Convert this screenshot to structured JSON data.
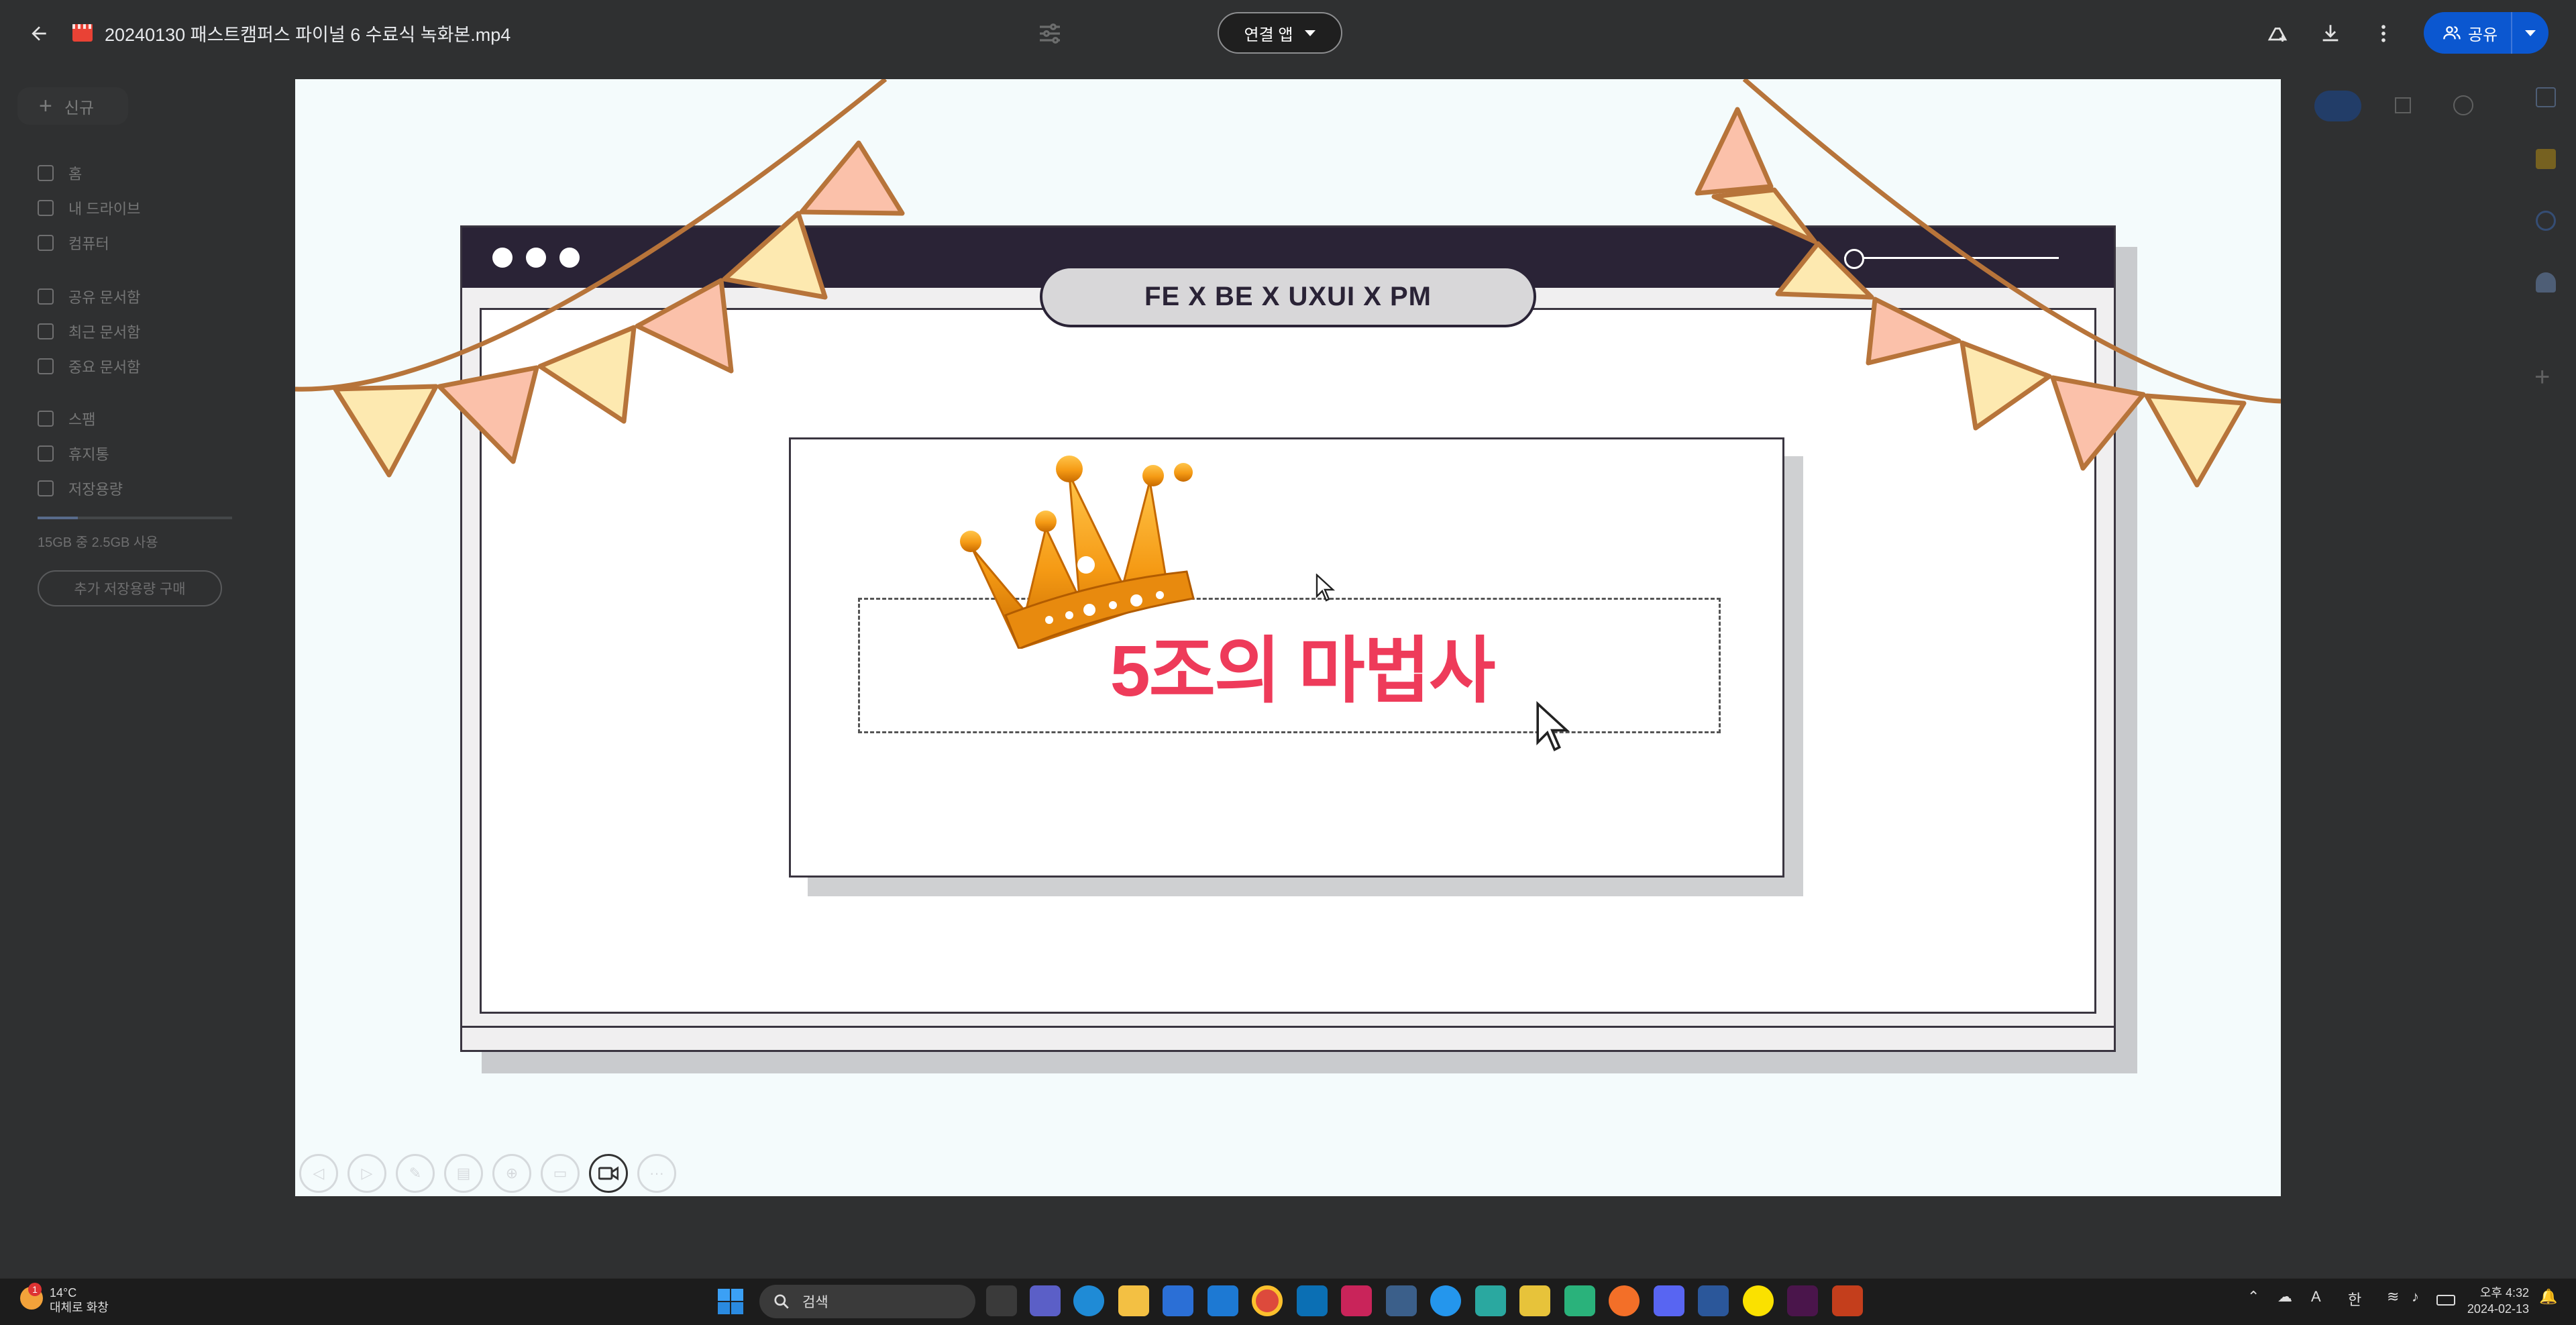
{
  "window": {
    "title": "20240130 패스트캠퍼스 파이널 6 수료식 녹화본.mp4"
  },
  "toolbar": {
    "open_with_label": "연결 앱",
    "share_label": "공유"
  },
  "sidebar": {
    "new_label": "신규",
    "items": [
      {
        "label": "홈"
      },
      {
        "label": "내 드라이브"
      },
      {
        "label": "컴퓨터"
      },
      {
        "label": "공유 문서함"
      },
      {
        "label": "최근 문서함"
      },
      {
        "label": "중요 문서함"
      },
      {
        "label": "스팸"
      },
      {
        "label": "휴지통"
      },
      {
        "label": "저장용량"
      }
    ],
    "storage_text": "15GB 중 2.5GB 사용",
    "buy_storage_label": "추가 저장용량 구매"
  },
  "video": {
    "tag_text": "FE X BE X UXUI X PM",
    "main_title": "5조의 마법사"
  },
  "player_controls": [
    {
      "name": "prev-slide"
    },
    {
      "name": "next-slide"
    },
    {
      "name": "pen"
    },
    {
      "name": "slides"
    },
    {
      "name": "zoom"
    },
    {
      "name": "subtitles"
    },
    {
      "name": "camera"
    },
    {
      "name": "more"
    }
  ],
  "taskbar": {
    "weather_temp": "14°C",
    "weather_desc": "대체로 화창",
    "search_placeholder": "검색",
    "ime_a": "A",
    "ime_han": "한",
    "time": "오후 4:32",
    "date": "2024-02-13"
  },
  "colors": {
    "accent": "#0b57d0",
    "title_pink": "#ee3b5a",
    "window_dark": "#2a2336"
  }
}
